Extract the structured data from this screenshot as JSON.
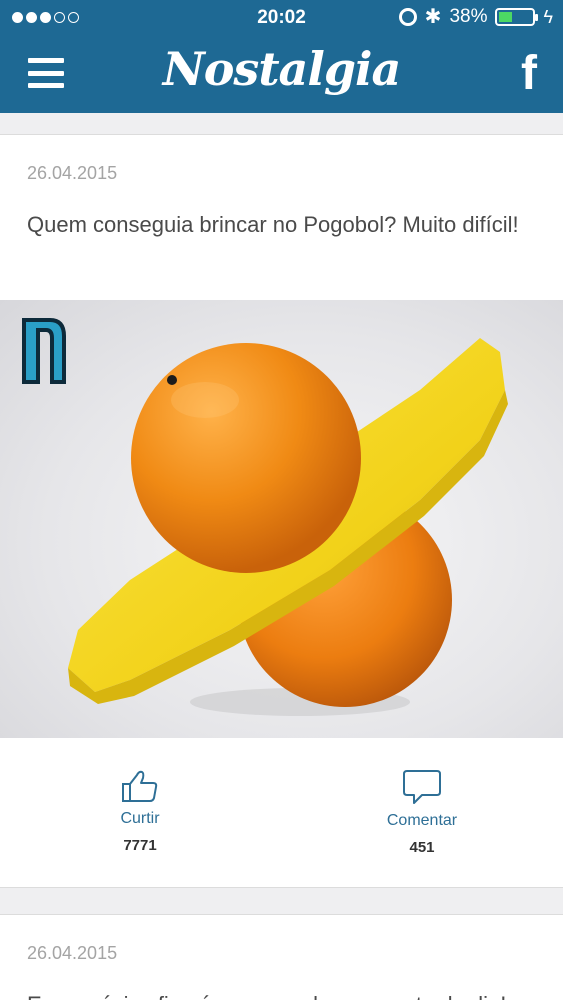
{
  "status_bar": {
    "time": "20:02",
    "battery_percent": "38%",
    "battery_level": 0.38,
    "signal_bars_filled": 3,
    "signal_bars_total": 5
  },
  "nav": {
    "logo_text": "Nostalgia",
    "facebook_icon_text": "f"
  },
  "posts": [
    {
      "date": "26.04.2015",
      "title": "Quem conseguia brincar no Pogobol? Muito difícil!",
      "watermark_letter": "N",
      "like_label": "Curtir",
      "like_count": "7771",
      "comment_label": "Comentar",
      "comment_count": "451"
    },
    {
      "date": "26.04.2015",
      "title": "Essa música ficará na sua cabeça o resto do dia!"
    }
  ],
  "colors": {
    "nav_bg": "#1e6994",
    "action_blue": "#2e6f96",
    "battery_green": "#4cd964"
  }
}
